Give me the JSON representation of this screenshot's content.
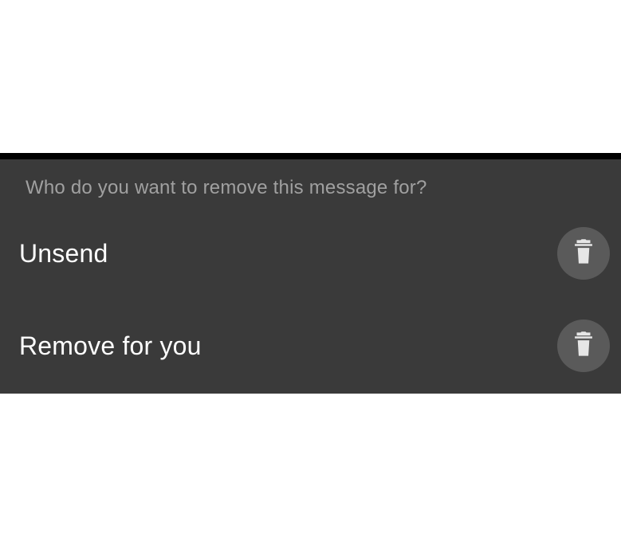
{
  "dialog": {
    "title": "Who do you want to remove this message for?",
    "options": [
      {
        "label": "Unsend"
      },
      {
        "label": "Remove for you"
      }
    ]
  }
}
